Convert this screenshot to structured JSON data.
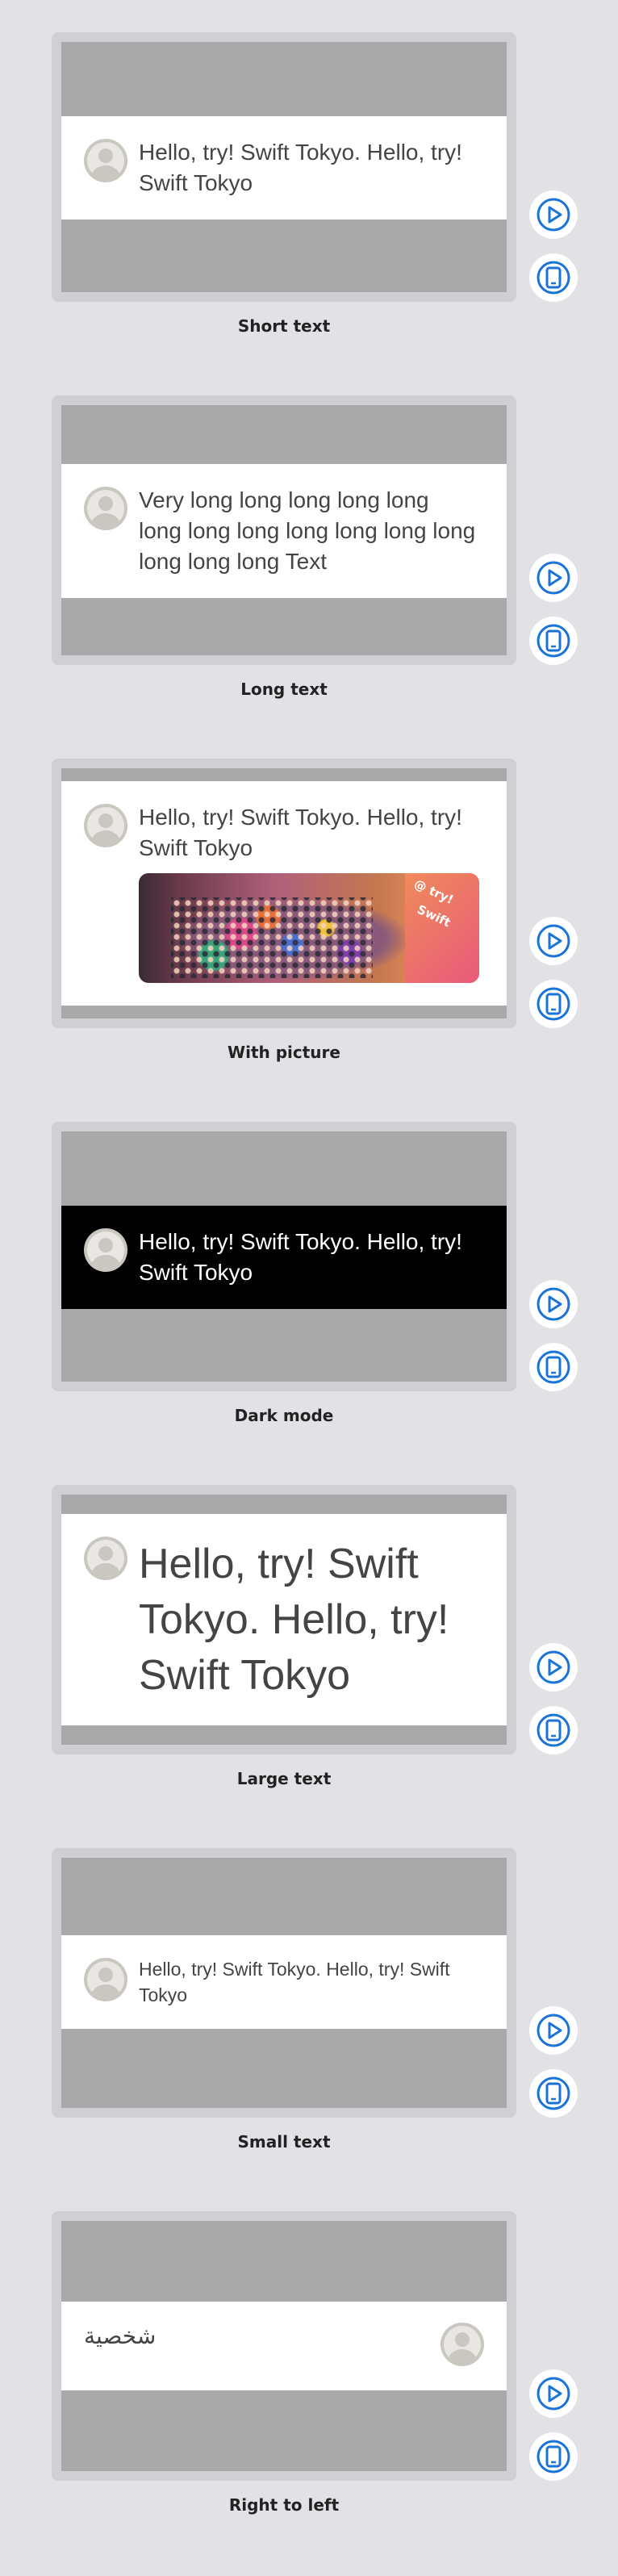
{
  "message": "Hello, try! Swift Tokyo. Hello, try! Swift Tokyo",
  "previews": [
    {
      "label": "Short text",
      "text": "Hello, try! Swift Tokyo. Hello, try! Swift Tokyo"
    },
    {
      "label": "Long text",
      "text": "Very long long long long long long long long long long long long long long long Text"
    },
    {
      "label": "With picture",
      "text": "Hello, try! Swift Tokyo. Hello, try! Swift Tokyo"
    },
    {
      "label": "Dark mode",
      "text": "Hello, try! Swift Tokyo. Hello, try! Swift Tokyo"
    },
    {
      "label": "Large text",
      "text": "Hello, try! Swift Tokyo. Hello, try! Swift Tokyo"
    },
    {
      "label": "Small text",
      "text": "Hello, try! Swift Tokyo. Hello, try! Swift Tokyo"
    },
    {
      "label": "Right to left",
      "text": "شخصية"
    }
  ],
  "photo_sign_text": [
    "@ try!",
    "Swift"
  ],
  "icons": {
    "play": "play-circle-icon",
    "device": "device-settings-icon"
  },
  "colors": {
    "background": "#e1e1e6",
    "frame": "#d0d0d4",
    "screen": "#a9a9a9",
    "accent": "#1a73d9"
  }
}
